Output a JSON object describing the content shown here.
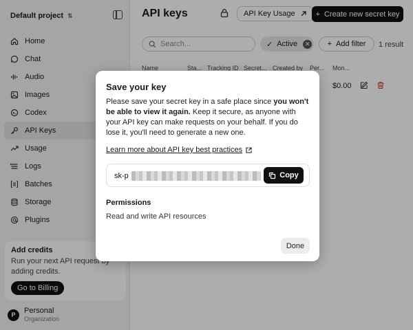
{
  "sidebar": {
    "project_name": "Default project",
    "items": [
      {
        "label": "Home",
        "icon": "home-icon"
      },
      {
        "label": "Chat",
        "icon": "chat-icon"
      },
      {
        "label": "Audio",
        "icon": "audio-icon"
      },
      {
        "label": "Images",
        "icon": "image-icon"
      },
      {
        "label": "Codex",
        "icon": "codex-icon"
      },
      {
        "label": "API Keys",
        "icon": "key-icon",
        "active": true
      },
      {
        "label": "Usage",
        "icon": "usage-icon"
      },
      {
        "label": "Logs",
        "icon": "logs-icon"
      },
      {
        "label": "Batches",
        "icon": "batches-icon"
      },
      {
        "label": "Storage",
        "icon": "storage-icon"
      },
      {
        "label": "Plugins",
        "icon": "plugins-icon"
      }
    ],
    "credits": {
      "title": "Add credits",
      "description": "Run your next API request by adding credits.",
      "button": "Go to Billing"
    },
    "account": {
      "avatar_letter": "P",
      "name": "Personal",
      "org": "Organization"
    }
  },
  "main": {
    "title": "API keys",
    "usage_button": "API Key Usage",
    "create_button": "Create new secret key",
    "search_placeholder": "Search...",
    "active_filter": "Active",
    "add_filter": "Add filter",
    "result_count": "1 result",
    "columns": [
      "Name",
      "Sta...",
      "Tracking ID",
      "Secret...",
      "Created by",
      "Per...",
      "Mon..."
    ],
    "row_value": "$0.00"
  },
  "modal": {
    "title": "Save your key",
    "description_pre": "Please save your secret key in a safe place since ",
    "description_bold": "you won't be able to view it again.",
    "description_post": " Keep it secure, as anyone with your API key can make requests on your behalf. If you do lose it, you'll need to generate a new one.",
    "link": "Learn more about API key best practices",
    "key_prefix": "sk-p",
    "copy_button": "Copy",
    "permissions_label": "Permissions",
    "permissions_value": "Read and write API resources",
    "done_button": "Done"
  }
}
